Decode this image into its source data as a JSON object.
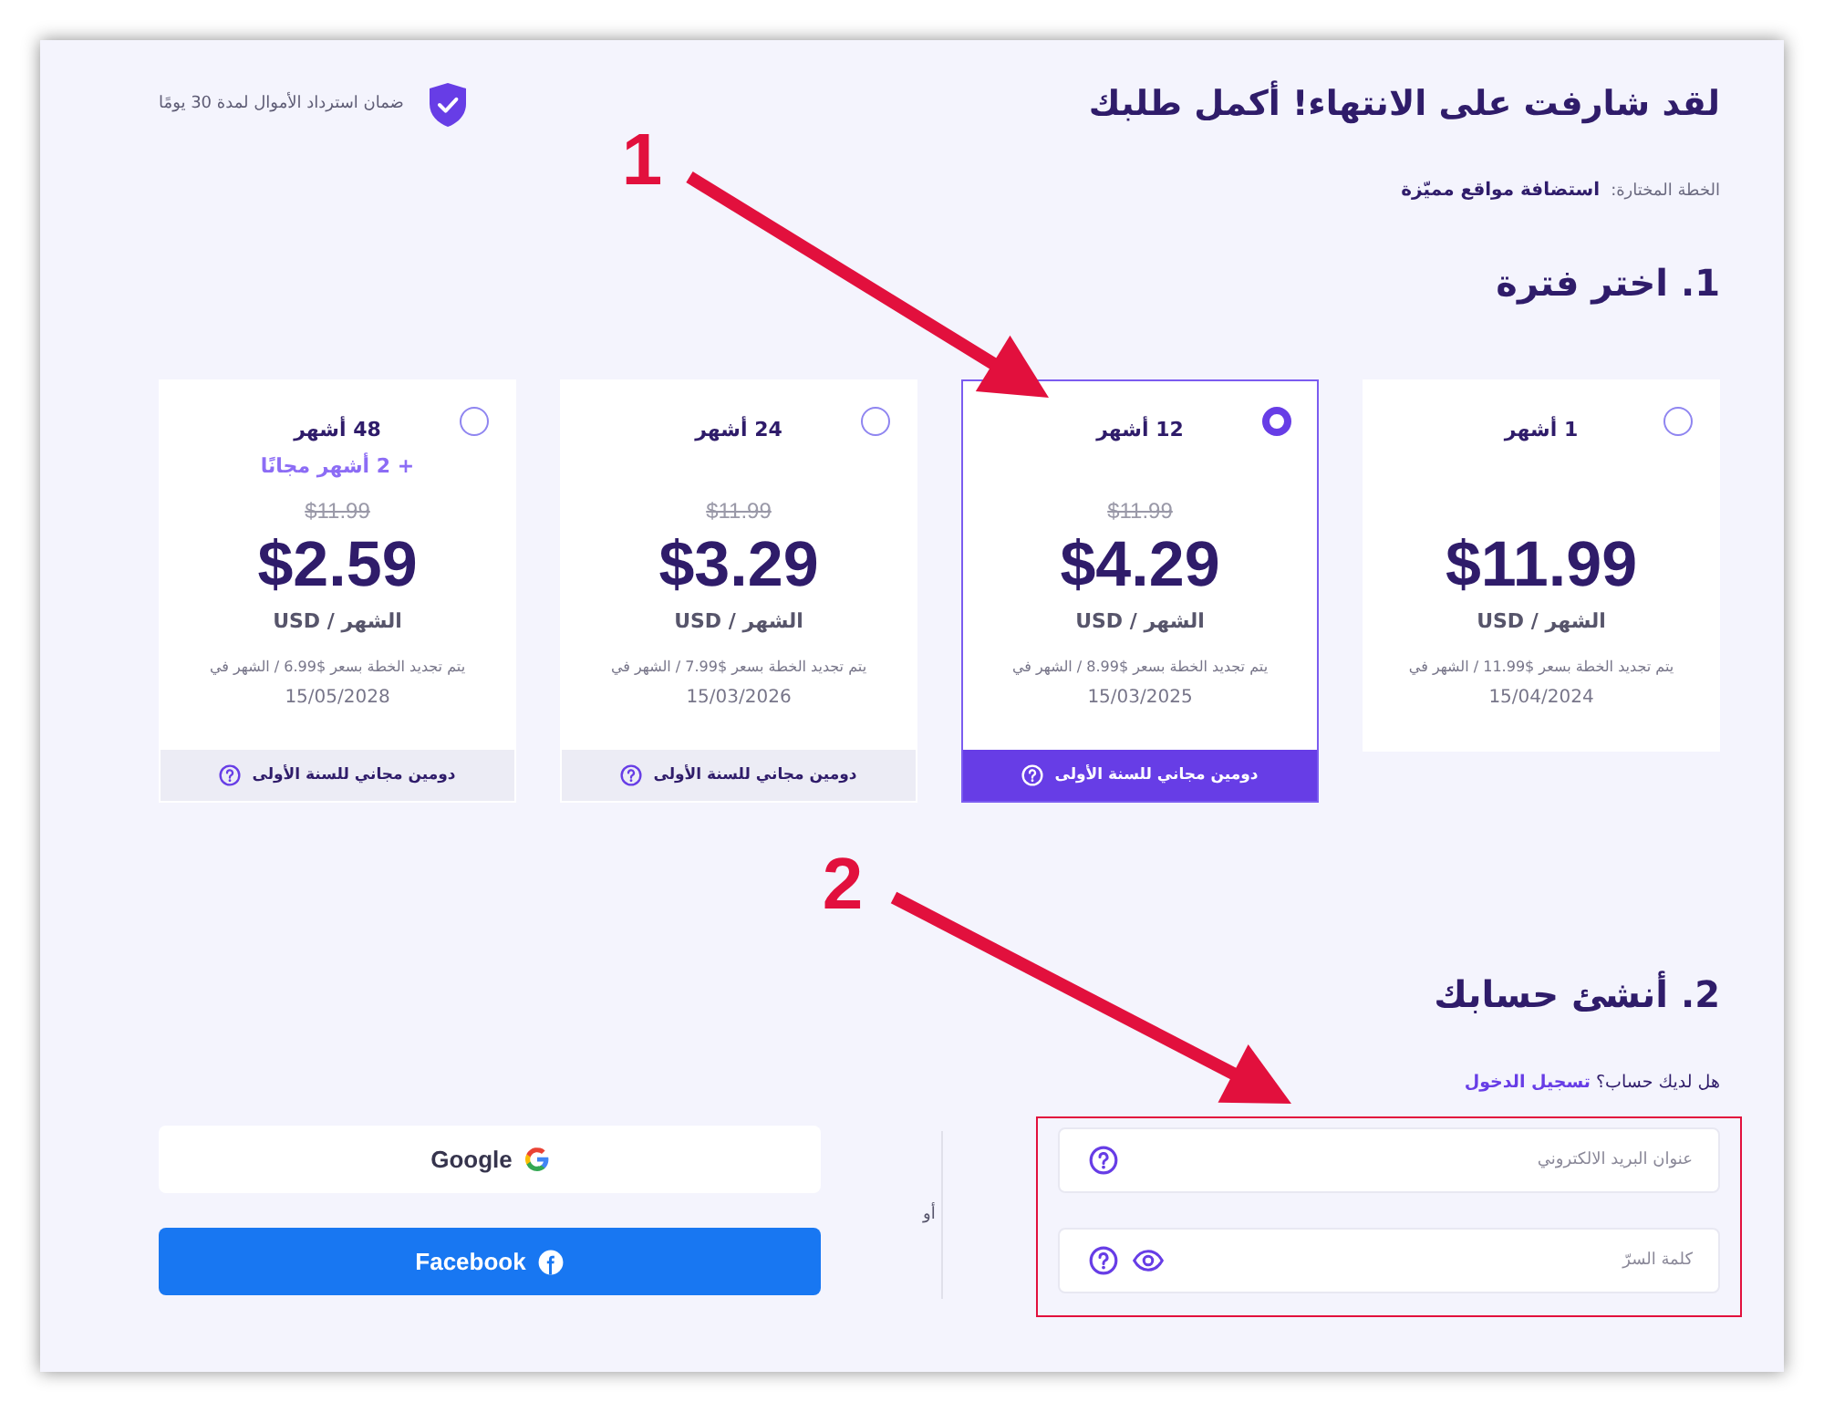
{
  "header": {
    "title": "لقد شارفت على الانتهاء! أكمل طلبك",
    "guarantee": "ضمان استرداد الأموال لمدة 30 يومًا"
  },
  "plan": {
    "label": "الخطة المختارة:",
    "name": "استضافة مواقع مميّزة"
  },
  "period_section": {
    "heading": "1. اختر فترة",
    "periods": [
      {
        "label": "1 أشهر",
        "selected": false,
        "price": "$11.99",
        "unit": "USD / الشهر",
        "renewal": "يتم تجديد الخطة بسعر $11.99 / الشهر في",
        "renewal_date": "15/04/2024"
      },
      {
        "label": "12 أشهر",
        "selected": true,
        "old_price": "$11.99",
        "price": "$4.29",
        "unit": "USD / الشهر",
        "renewal": "يتم تجديد الخطة بسعر $8.99 / الشهر في",
        "renewal_date": "15/03/2025",
        "perk": "دومين مجاني للسنة الأولى"
      },
      {
        "label": "24 أشهر",
        "selected": false,
        "old_price": "$11.99",
        "price": "$3.29",
        "unit": "USD / الشهر",
        "renewal": "يتم تجديد الخطة بسعر $7.99 / الشهر في",
        "renewal_date": "15/03/2026",
        "perk": "دومين مجاني للسنة الأولى"
      },
      {
        "label": "48 أشهر",
        "selected": false,
        "bonus": "+ 2 أشهر مجانًا",
        "old_price": "$11.99",
        "price": "$2.59",
        "unit": "USD / الشهر",
        "renewal": "يتم تجديد الخطة بسعر $6.99 / الشهر في",
        "renewal_date": "15/05/2028",
        "perk": "دومين مجاني للسنة الأولى"
      }
    ]
  },
  "account_section": {
    "heading": "2. أنشئ حسابك",
    "login_prompt": "هل لديك حساب؟",
    "login_link": "تسجيل الدخول",
    "highlighted": true,
    "fields": [
      {
        "kind": "email",
        "placeholder": "عنوان البريد الالكتروني"
      },
      {
        "kind": "password",
        "placeholder": "كلمة السرّ"
      }
    ],
    "separator": "أو",
    "social_buttons": [
      {
        "kind": "google",
        "label": "Google"
      },
      {
        "kind": "facebook",
        "label": "Facebook"
      }
    ]
  },
  "annotations": [
    {
      "number": "1"
    },
    {
      "number": "2"
    }
  ]
}
